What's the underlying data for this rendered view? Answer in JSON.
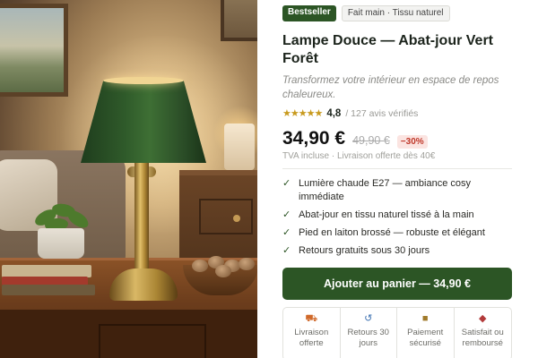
{
  "badges": {
    "bestseller": "Bestseller",
    "info": "Fait main · Tissu naturel"
  },
  "product": {
    "title": "Lampe Douce — Abat-jour Vert Forêt",
    "subtitle": "Transformez votre intérieur en espace de repos chaleureux."
  },
  "rating": {
    "stars": "★★★★★",
    "value": "4,8",
    "count": "/ 127 avis vérifiés"
  },
  "pricing": {
    "price": "34,90 €",
    "old_price": "49,90 €",
    "discount": "−30%",
    "shipping_note": "TVA incluse · Livraison offerte dès 40€"
  },
  "features": [
    "Lumière chaude E27 — ambiance cosy immédiate",
    "Abat-jour en tissu naturel tissé à la main",
    "Pied en laiton brossé — robuste et élégant",
    "Retours gratuits sous 30 jours"
  ],
  "cta": {
    "label": "Ajouter au panier — 34,90 €"
  },
  "trust": [
    {
      "icon": "truck-icon",
      "label": "Livraison offerte"
    },
    {
      "icon": "return-icon",
      "label": "Retours 30 jours"
    },
    {
      "icon": "lock-icon",
      "label": "Paiement sécurisé"
    },
    {
      "icon": "shield-icon",
      "label": "Satisfait ou remboursé"
    }
  ],
  "colors": {
    "accent": "#2c5525",
    "discount": "#c0392b",
    "stars": "#c89a1e"
  }
}
